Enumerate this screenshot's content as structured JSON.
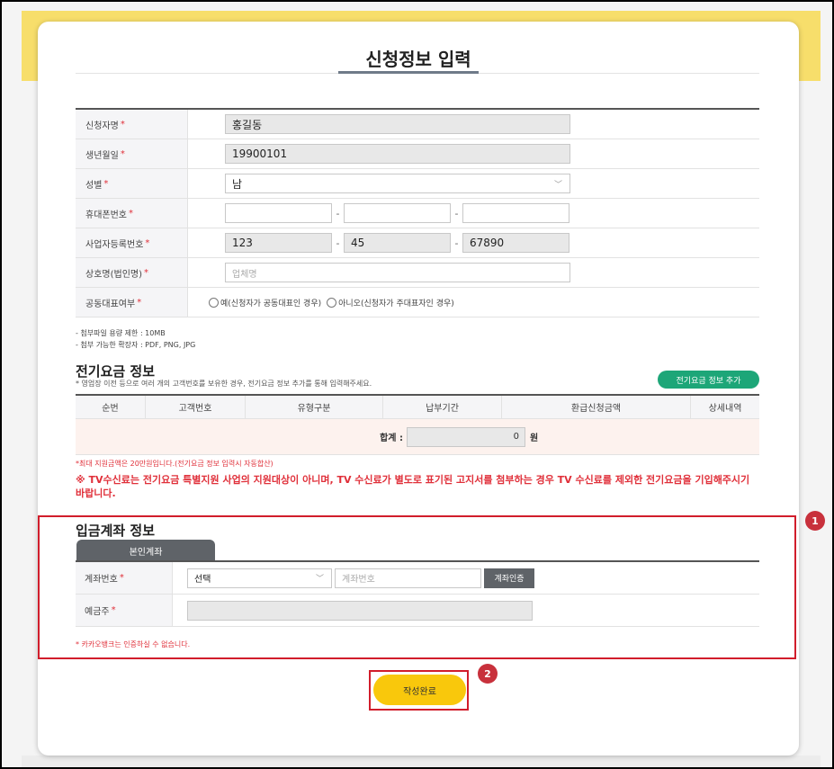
{
  "page_title": "신청정보 입력",
  "form": {
    "name": {
      "label": "신청자명",
      "value": "홍길동"
    },
    "birth": {
      "label": "생년월일",
      "value": "19900101"
    },
    "gender": {
      "label": "성별",
      "value": "남"
    },
    "phone": {
      "label": "휴대폰번호",
      "p1": "",
      "p2": "",
      "p3": ""
    },
    "biz_no": {
      "label": "사업자등록번호",
      "p1": "123",
      "p2": "45",
      "p3": "67890"
    },
    "company": {
      "label": "상호명(법인명)",
      "placeholder": "업체명"
    },
    "joint": {
      "label": "공동대표여부",
      "option_yes": "예(신청자가 공동대표인 경우)",
      "option_no": "아니오(신청자가 주대표자인 경우)"
    },
    "required_mark": "*"
  },
  "notes": {
    "line1": "- 첨부파일 용량 제한 : 10MB",
    "line2": "- 첨부 가능한 확장자 : PDF, PNG, JPG"
  },
  "electric": {
    "title": "전기요금 정보",
    "subtitle": "* 영업장 이전 등으로 여러 개의 고객번호를 보유한 경우, 전기요금 정보 추가를 통해 입력해주세요.",
    "add_button": "전기요금 정보 추가",
    "columns": [
      "순번",
      "고객번호",
      "유형구분",
      "납부기간",
      "환급신청금액",
      "상세내역"
    ],
    "total_label": "합계 :",
    "total_value": "0",
    "total_unit": "원",
    "max_note": "*최대 지원금액은 20만원입니다.(전기요금 정보 입력시 자동합산)",
    "tv_warning": "※ TV수신료는 전기요금 특별지원 사업의 지원대상이 아니며, TV 수신료가 별도로 표기된 고지서를 첨부하는 경우 TV 수신료를 제외한 전기요금을 기입해주시기 바랍니다."
  },
  "account": {
    "title": "입금계좌 정보",
    "tab": "본인계좌",
    "account_label": "계좌번호",
    "bank_select": "선택",
    "account_placeholder": "계좌번호",
    "verify_button": "계좌인증",
    "holder_label": "예금주",
    "holder_value": "",
    "kakao_note": "* 카카오뱅크는 인증하실 수 없습니다."
  },
  "submit_button": "작성완료",
  "badges": {
    "one": "1",
    "two": "2"
  },
  "colors": {
    "accent_yellow": "#f9c80c",
    "header_yellow": "#f7de6b",
    "green": "#1da678",
    "red": "#e0303a",
    "highlight_red": "#d11d2b"
  }
}
